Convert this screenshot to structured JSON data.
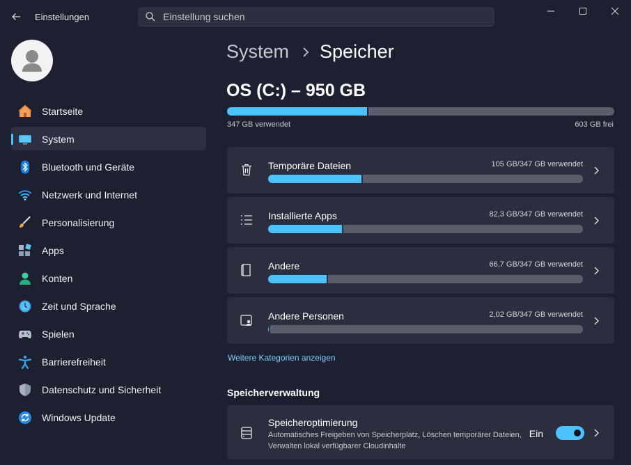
{
  "titlebar": {
    "app_title": "Einstellungen",
    "search_placeholder": "Einstellung suchen"
  },
  "nav": {
    "items": [
      {
        "label": "Startseite",
        "icon": "home-icon",
        "active": false
      },
      {
        "label": "System",
        "icon": "monitor-icon",
        "active": true
      },
      {
        "label": "Bluetooth und Geräte",
        "icon": "bluetooth-icon",
        "active": false
      },
      {
        "label": "Netzwerk und Internet",
        "icon": "wifi-icon",
        "active": false
      },
      {
        "label": "Personalisierung",
        "icon": "brush-icon",
        "active": false
      },
      {
        "label": "Apps",
        "icon": "apps-icon",
        "active": false
      },
      {
        "label": "Konten",
        "icon": "account-icon",
        "active": false
      },
      {
        "label": "Zeit und Sprache",
        "icon": "clock-globe-icon",
        "active": false
      },
      {
        "label": "Spielen",
        "icon": "gamepad-icon",
        "active": false
      },
      {
        "label": "Barrierefreiheit",
        "icon": "accessibility-icon",
        "active": false
      },
      {
        "label": "Datenschutz und Sicherheit",
        "icon": "shield-icon",
        "active": false
      },
      {
        "label": "Windows Update",
        "icon": "update-icon",
        "active": false
      }
    ]
  },
  "main": {
    "breadcrumb_parent": "System",
    "breadcrumb_current": "Speicher",
    "drive_title": "OS (C:) – 950 GB",
    "used_label": "347 GB verwendet",
    "free_label": "603 GB frei",
    "used_fraction": 0.365,
    "categories": [
      {
        "name": "Temporäre Dateien",
        "value": "105 GB/347 GB verwendet",
        "fraction": 0.3,
        "icon": "trash-icon"
      },
      {
        "name": "Installierte Apps",
        "value": "82,3 GB/347 GB verwendet",
        "fraction": 0.24,
        "icon": "list-icon"
      },
      {
        "name": "Andere",
        "value": "66,7 GB/347 GB verwendet",
        "fraction": 0.19,
        "icon": "document-icon"
      },
      {
        "name": "Andere Personen",
        "value": "2,02 GB/347 GB verwendet",
        "fraction": 0.006,
        "icon": "people-icon"
      }
    ],
    "more_categories_link": "Weitere Kategorien anzeigen",
    "section_title": "Speicherverwaltung",
    "optimization": {
      "title": "Speicheroptimierung",
      "description": "Automatisches Freigeben von Speicherplatz, Löschen temporärer Dateien, Verwalten lokal verfügbarer Cloudinhalte",
      "state_label": "Ein",
      "enabled": true
    }
  },
  "colors": {
    "accent": "#4cc2ff",
    "background": "#1c2030",
    "card": "#2a2e3e"
  }
}
